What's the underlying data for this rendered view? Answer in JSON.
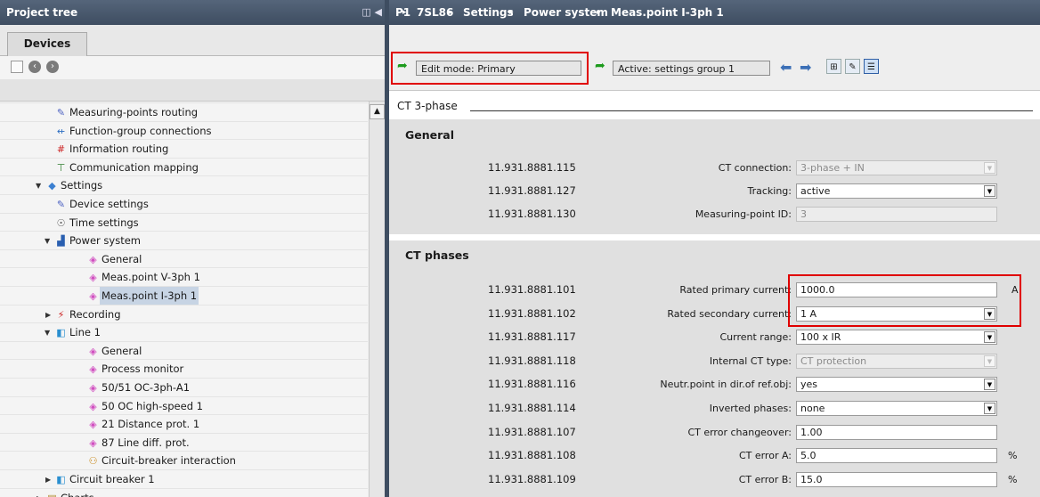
{
  "left_pane": {
    "title": "Project tree",
    "collapse_glyph": "◫ ◀",
    "tab": "Devices",
    "tree": [
      {
        "label": "Measuring-points routing",
        "indent": 0,
        "icon": "routing-icon",
        "arrow": ""
      },
      {
        "label": "Function-group connections",
        "indent": 0,
        "icon": "connections-icon",
        "arrow": ""
      },
      {
        "label": "Information routing",
        "indent": 0,
        "icon": "information-routing-icon",
        "arrow": ""
      },
      {
        "label": "Communication mapping",
        "indent": 0,
        "icon": "communication-icon",
        "arrow": ""
      },
      {
        "label": "Settings",
        "indent": -1,
        "icon": "settings-folder-icon",
        "arrow": "▼"
      },
      {
        "label": "Device settings",
        "indent": 0,
        "icon": "device-settings-icon",
        "arrow": ""
      },
      {
        "label": "Time settings",
        "indent": 0,
        "icon": "time-settings-icon",
        "arrow": ""
      },
      {
        "label": "Power system",
        "indent": 0,
        "icon": "power-system-icon",
        "arrow": "▼"
      },
      {
        "label": "General",
        "indent": 1,
        "icon": "general-icon",
        "arrow": ""
      },
      {
        "label": "Meas.point V-3ph 1",
        "indent": 1,
        "icon": "measpoint-icon",
        "arrow": ""
      },
      {
        "label": "Meas.point I-3ph 1",
        "indent": 1,
        "icon": "measpoint-icon",
        "arrow": "",
        "selected": true
      },
      {
        "label": "Recording",
        "indent": 0,
        "icon": "recording-icon",
        "arrow": "▶"
      },
      {
        "label": "Line 1",
        "indent": 0,
        "icon": "line-icon",
        "arrow": "▼"
      },
      {
        "label": "General",
        "indent": 1,
        "icon": "general-icon",
        "arrow": ""
      },
      {
        "label": "Process monitor",
        "indent": 1,
        "icon": "function-icon",
        "arrow": ""
      },
      {
        "label": "50/51 OC-3ph-A1",
        "indent": 1,
        "icon": "function-icon",
        "arrow": ""
      },
      {
        "label": "50 OC high-speed 1",
        "indent": 1,
        "icon": "function-icon",
        "arrow": ""
      },
      {
        "label": "21 Distance prot. 1",
        "indent": 1,
        "icon": "function-icon",
        "arrow": ""
      },
      {
        "label": "87 Line diff. prot.",
        "indent": 1,
        "icon": "function-icon",
        "arrow": ""
      },
      {
        "label": "Circuit-breaker interaction",
        "indent": 1,
        "icon": "interaction-icon",
        "arrow": ""
      },
      {
        "label": "Circuit breaker 1",
        "indent": 0,
        "icon": "breaker-icon",
        "arrow": "▶"
      },
      {
        "label": "Charts",
        "indent": -1,
        "icon": "charts-folder-icon",
        "arrow": "▶"
      }
    ]
  },
  "breadcrumb": [
    "P1",
    "7SL86",
    "Settings",
    "Power system",
    "Meas.point I-3ph 1"
  ],
  "breadcrumb_sep": "▸",
  "toolbar": {
    "edit_mode": "Edit mode: Primary",
    "active_group": "Active: settings group 1"
  },
  "section": {
    "title": "CT 3-phase"
  },
  "general": {
    "title": "General",
    "params": [
      {
        "id": "11.931.8881.115",
        "label": "CT connection:",
        "value": "3-phase + IN",
        "type": "dropdown",
        "disabled": true
      },
      {
        "id": "11.931.8881.127",
        "label": "Tracking:",
        "value": "active",
        "type": "dropdown",
        "disabled": false
      },
      {
        "id": "11.931.8881.130",
        "label": "Measuring-point ID:",
        "value": "3",
        "type": "text",
        "disabled": true
      }
    ]
  },
  "ct_phases": {
    "title": "CT phases",
    "params": [
      {
        "id": "11.931.8881.101",
        "label": "Rated primary current:",
        "value": "1000.0",
        "type": "text",
        "unit": "A",
        "disabled": false
      },
      {
        "id": "11.931.8881.102",
        "label": "Rated secondary current:",
        "value": "1 A",
        "type": "dropdown",
        "disabled": false
      },
      {
        "id": "11.931.8881.117",
        "label": "Current range:",
        "value": "100 x IR",
        "type": "dropdown",
        "disabled": false
      },
      {
        "id": "11.931.8881.118",
        "label": "Internal CT type:",
        "value": "CT protection",
        "type": "dropdown",
        "disabled": true
      },
      {
        "id": "11.931.8881.116",
        "label": "Neutr.point in dir.of ref.obj:",
        "value": "yes",
        "type": "dropdown",
        "disabled": false
      },
      {
        "id": "11.931.8881.114",
        "label": "Inverted phases:",
        "value": "none",
        "type": "dropdown",
        "disabled": false
      },
      {
        "id": "11.931.8881.107",
        "label": "CT error changeover:",
        "value": "1.00",
        "type": "text",
        "disabled": false
      },
      {
        "id": "11.931.8881.108",
        "label": "CT error A:",
        "value": "5.0",
        "type": "text",
        "unit": "%",
        "disabled": false
      },
      {
        "id": "11.931.8881.109",
        "label": "CT error B:",
        "value": "15.0",
        "type": "text",
        "unit": "%",
        "disabled": false
      }
    ]
  },
  "colors": {
    "header": "#3e4d61",
    "panel": "#e0e0e0",
    "highlight": "#e00000",
    "arrow": "#1d9b1d"
  }
}
